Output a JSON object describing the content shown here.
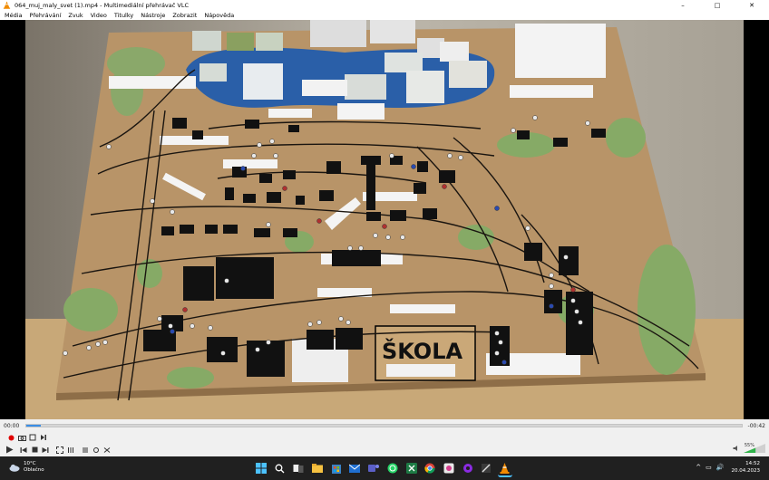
{
  "window": {
    "title": "064_muj_maly_svet (1).mp4 - Multimediální přehrávač VLC",
    "minimize_glyph": "–",
    "maximize_glyph": "□",
    "close_glyph": "✕"
  },
  "menu": [
    "Média",
    "Přehrávání",
    "Zvuk",
    "Video",
    "Titulky",
    "Nástroje",
    "Zobrazit",
    "Nápověda"
  ],
  "video": {
    "board_labels": [
      "ŠKOLA"
    ]
  },
  "player": {
    "elapsed": "00:00",
    "remaining": "-00:42",
    "progress": 0.02,
    "volume": "55%",
    "volume_level": 0.55
  },
  "taskbar": {
    "temperature": "10°C",
    "condition": "Oblačno",
    "time": "14:52",
    "date": "20.04.2023",
    "tray_up_glyph": "^",
    "tray_network_glyph": "▭",
    "tray_sound_glyph": "🔊"
  },
  "colors": {
    "accent": "#3a8ee6",
    "record": "#e00000",
    "vlc_orange": "#f08a00",
    "taskbar": "#202020"
  }
}
